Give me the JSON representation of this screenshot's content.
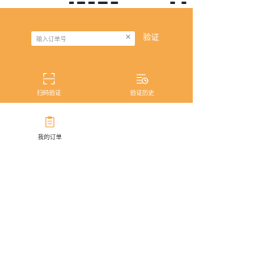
{
  "search": {
    "placeholder": "输入订单号",
    "value": "",
    "verify_label": "验证"
  },
  "actions": [
    {
      "label": "扫码验证",
      "icon": "scan-icon"
    },
    {
      "label": "验证历史",
      "icon": "history-icon"
    }
  ],
  "menu": [
    {
      "label": "我的订单",
      "icon": "order-icon"
    }
  ],
  "colors": {
    "header": "#f5a94b",
    "accent": "#f5a94b",
    "background": "#ffffff",
    "text_dark": "#333333"
  }
}
